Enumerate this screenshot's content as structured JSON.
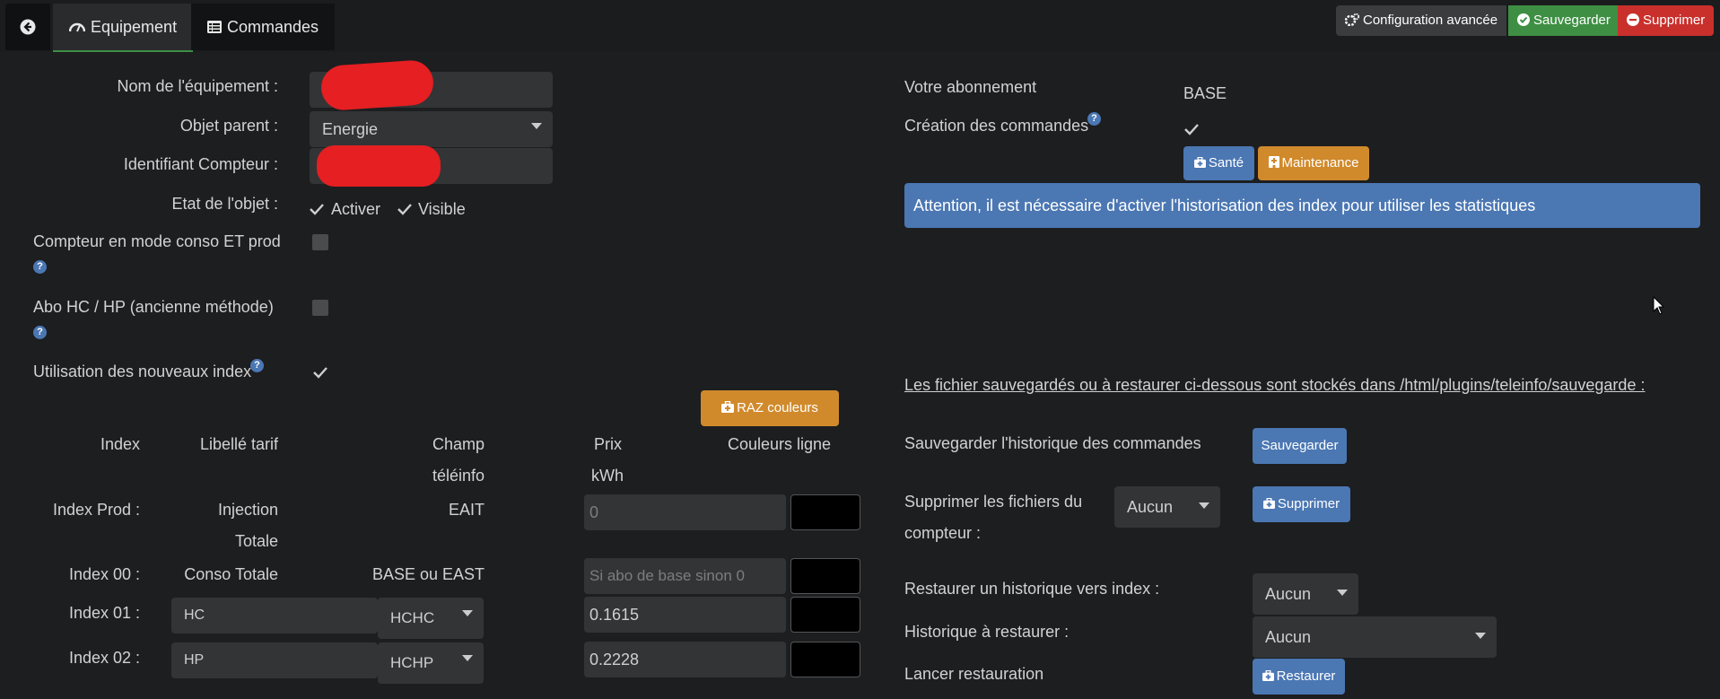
{
  "tabs": {
    "equipment": "Equipement",
    "commands": "Commandes"
  },
  "toolbar": {
    "config": "Configuration avancée",
    "save": "Sauvegarder",
    "delete": "Supprimer"
  },
  "form": {
    "name_label": "Nom de l'équipement :",
    "name_value": "",
    "parent_label": "Objet parent :",
    "parent_value": "Energie",
    "counter_id_label": "Identifiant Compteur :",
    "counter_id_value": "",
    "state_label": "Etat de l'objet :",
    "activate": "Activer",
    "visible": "Visible",
    "conso_prod_label": "Compteur en mode conso ET prod",
    "hchp_label": "Abo HC / HP (ancienne méthode)",
    "new_index_label": "Utilisation des nouveaux index"
  },
  "raz_button": "RAZ couleurs",
  "index_table": {
    "headers": {
      "index": "Index",
      "tariff": "Libellé tarif",
      "field_1": "Champ",
      "field_2": "téléinfo",
      "price_1": "Prix",
      "price_2": "kWh",
      "colors": "Couleurs ligne"
    },
    "rows": [
      {
        "index": "Index Prod :",
        "tariff_1": "Injection",
        "tariff_2": "Totale",
        "field": "EAIT",
        "price_placeholder": "0"
      },
      {
        "index": "Index 00 :",
        "tariff_1": "Conso Totale",
        "field": "BASE ou EAST",
        "price_placeholder": "Si abo de base sinon 0"
      },
      {
        "index": "Index 01 :",
        "tariff_value": "HC",
        "field_select": "HCHC",
        "price": "0.1615"
      },
      {
        "index": "Index 02 :",
        "tariff_value": "HP",
        "field_select": "HCHP",
        "price": "0.2228"
      }
    ]
  },
  "subscription": {
    "label": "Votre abonnement",
    "value": "BASE",
    "commands_label": "Création des commandes",
    "health_button": "Santé",
    "maintenance_button": "Maintenance"
  },
  "alert": "Attention, il est nécessaire d'activer l'historisation des index pour utiliser les statistiques",
  "backup": {
    "info": "Les fichier sauvegardés ou à restaurer ci-dessous sont stockés dans /html/plugins/teleinfo/sauvegarde :",
    "save_history_label": "Sauvegarder l'historique des commandes",
    "save_button": "Sauvegarder",
    "delete_files_label_1": "Supprimer les fichiers du",
    "delete_files_label_2": "compteur :",
    "delete_select": "Aucun",
    "delete_button": "Supprimer",
    "restore_to_index_label": "Restaurer un historique vers index :",
    "restore_to_index_select": "Aucun",
    "history_to_restore_label": "Historique à restaurer :",
    "history_to_restore_select": "Aucun",
    "launch_restore_label": "Lancer restauration",
    "restore_button": "Restaurer"
  },
  "colors": {
    "accent_green": "#3e8f43",
    "primary_blue": "#4b77b3",
    "warning_orange": "#d08a2c",
    "danger_red": "#c9302c",
    "background": "#1d1e20"
  }
}
